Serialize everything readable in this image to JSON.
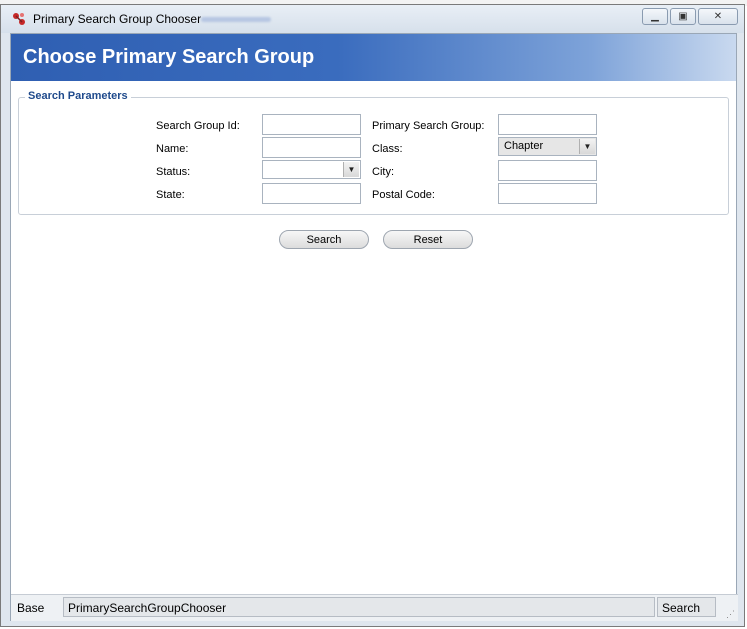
{
  "window": {
    "title": "Primary Search Group Chooser",
    "controls": {
      "minimize": "▁",
      "maximize": "▣",
      "close": "✕"
    }
  },
  "header": {
    "title": "Choose Primary Search Group"
  },
  "search_parameters": {
    "legend": "Search Parameters",
    "fields": {
      "search_group_id": {
        "label": "Search Group Id:",
        "value": ""
      },
      "name": {
        "label": "Name:",
        "value": ""
      },
      "status": {
        "label": "Status:",
        "value": ""
      },
      "state": {
        "label": "State:",
        "value": ""
      },
      "primary_search_group": {
        "label": "Primary Search Group:",
        "value": ""
      },
      "class": {
        "label": "Class:",
        "value": "Chapter"
      },
      "city": {
        "label": "City:",
        "value": ""
      },
      "postal_code": {
        "label": "Postal Code:",
        "value": ""
      }
    }
  },
  "buttons": {
    "search": "Search",
    "reset": "Reset"
  },
  "statusbar": {
    "left": "Base",
    "middle": "PrimarySearchGroupChooser",
    "right": "Search"
  },
  "colors": {
    "header_start": "#2f5fb2",
    "header_end": "#c9d9ef",
    "legend": "#1f4a8c"
  }
}
